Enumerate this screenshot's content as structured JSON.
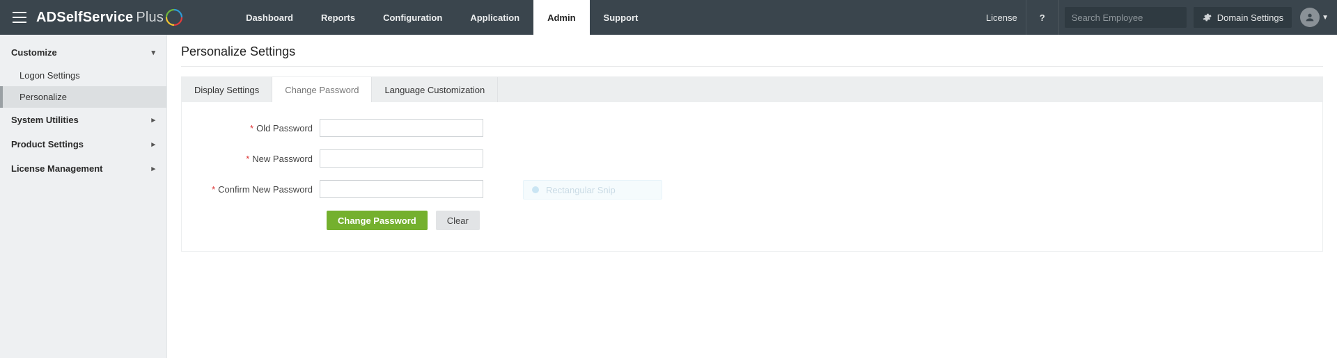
{
  "brand": {
    "main": "ADSelfService",
    "suffix": "Plus"
  },
  "nav": {
    "items": [
      {
        "label": "Dashboard"
      },
      {
        "label": "Reports"
      },
      {
        "label": "Configuration"
      },
      {
        "label": "Application"
      },
      {
        "label": "Admin",
        "active": true
      },
      {
        "label": "Support"
      }
    ]
  },
  "top_right": {
    "license": "License",
    "help": "?",
    "search_placeholder": "Search Employee",
    "domain_settings": "Domain Settings"
  },
  "sidebar": {
    "groups": [
      {
        "label": "Customize",
        "expanded": true,
        "children": [
          {
            "label": "Logon Settings"
          },
          {
            "label": "Personalize",
            "active": true
          }
        ]
      },
      {
        "label": "System Utilities"
      },
      {
        "label": "Product Settings"
      },
      {
        "label": "License Management"
      }
    ]
  },
  "page": {
    "title": "Personalize Settings"
  },
  "tabs": {
    "items": [
      {
        "label": "Display Settings"
      },
      {
        "label": "Change Password",
        "active": true
      },
      {
        "label": "Language Customization"
      }
    ]
  },
  "form": {
    "old_password_label": "Old Password",
    "new_password_label": "New Password",
    "confirm_password_label": "Confirm New Password",
    "submit_label": "Change Password",
    "clear_label": "Clear"
  },
  "ghost": {
    "label": "Rectangular Snip"
  },
  "colors": {
    "accent_green": "#74b02e",
    "header_bg": "#3a454d"
  }
}
